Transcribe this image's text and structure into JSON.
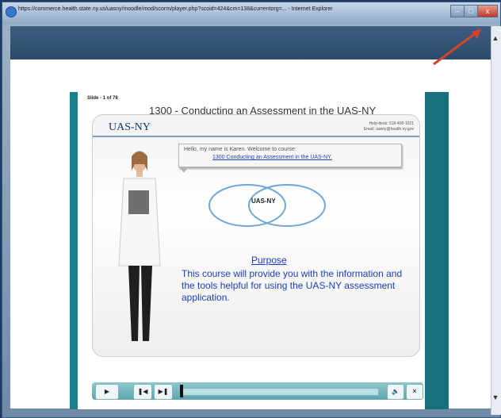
{
  "window": {
    "title": "https://commerce.health.state.ny.us/uasny/moodle/mod/scorm/player.php?scoid=424&cm=138&currentorg=... - Internet Explorer",
    "controls": {
      "minimize": "–",
      "maximize": "□",
      "close": "x"
    }
  },
  "slide": {
    "number": "Slide - 1 of 78",
    "title": "1300 - Conducting an Assessment in the UAS-NY",
    "logo": "UAS-NY",
    "helpdesk_line1": "Help-desk: 518-408-1021",
    "helpdesk_line2": "Email: uasny@health.ny.gov",
    "speech_line1": "Hello, my name is Karen. Welcome to course:",
    "speech_line2": "1300 Conducting an Assessment in the UAS-NY.",
    "venn_label": "UAS-NY",
    "purpose_heading": "Purpose",
    "purpose_text": "This course will provide you with the information and the tools helpful for using the UAS-NY assessment application."
  },
  "player": {
    "play_icon": "play-icon",
    "prev_icon": "skip-back-icon",
    "next_icon": "skip-forward-icon",
    "volume_icon": "speaker-icon",
    "exit_icon": "close-icon",
    "progress": 0.01
  },
  "colors": {
    "player_teal": "#1a7f8c",
    "link_blue": "#1a3fbf",
    "annotation_arrow": "#d0452b"
  }
}
